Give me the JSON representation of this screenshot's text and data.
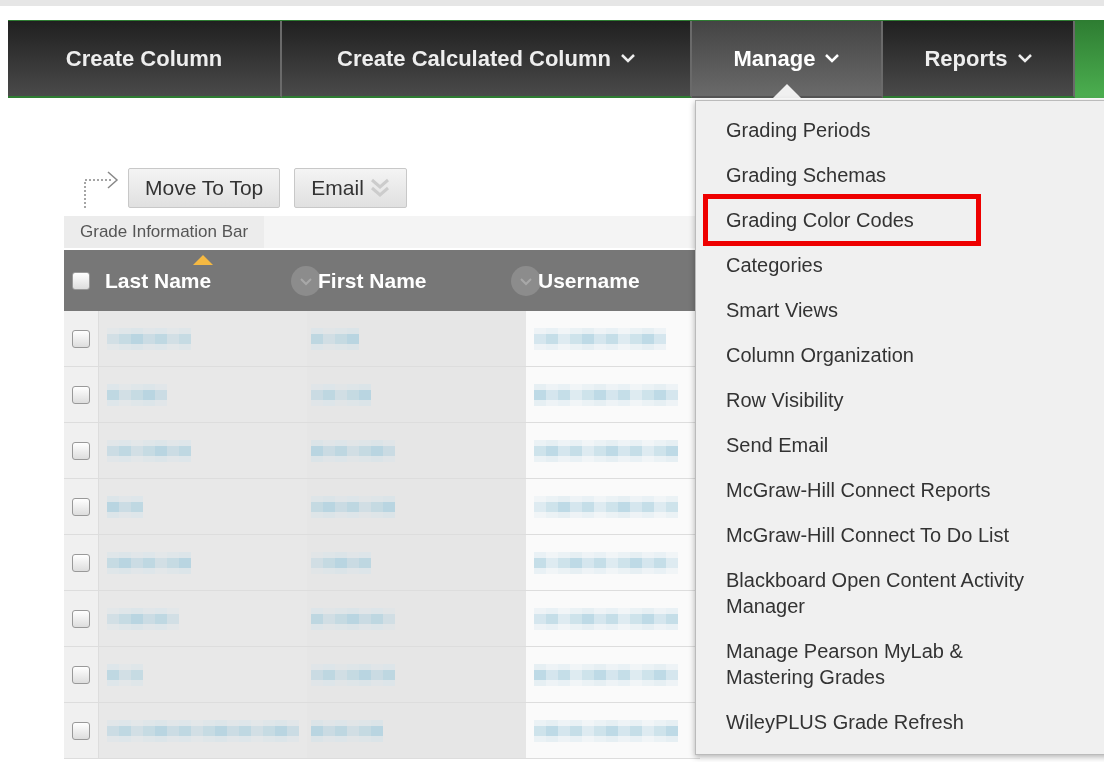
{
  "nav_tabs": [
    {
      "label": "Create Column",
      "has_menu": false,
      "selected": false
    },
    {
      "label": "Create Calculated Column",
      "has_menu": true,
      "selected": false
    },
    {
      "label": "Manage",
      "has_menu": true,
      "selected": true
    },
    {
      "label": "Reports",
      "has_menu": true,
      "selected": false
    }
  ],
  "toolbar": {
    "buttons": [
      {
        "label": "Move To Top",
        "has_menu": false
      },
      {
        "label": "Email",
        "has_menu": true
      }
    ]
  },
  "info_bar": {
    "label": "Grade Information Bar"
  },
  "table": {
    "select_all_checked": false,
    "columns": [
      {
        "label": "Last Name",
        "sorted": true
      },
      {
        "label": "First Name",
        "sorted": false
      },
      {
        "label": "Username",
        "sorted": false
      }
    ],
    "rows": [
      {
        "checked": false
      },
      {
        "checked": false
      },
      {
        "checked": false
      },
      {
        "checked": false
      },
      {
        "checked": false
      },
      {
        "checked": false
      },
      {
        "checked": false
      },
      {
        "checked": false
      }
    ]
  },
  "menu": {
    "items": [
      {
        "label": "Grading Periods",
        "highlighted": false
      },
      {
        "label": "Grading Schemas",
        "highlighted": false
      },
      {
        "label": "Grading Color Codes",
        "highlighted": true
      },
      {
        "label": "Categories",
        "highlighted": false
      },
      {
        "label": "Smart Views",
        "highlighted": false
      },
      {
        "label": "Column Organization",
        "highlighted": false
      },
      {
        "label": "Row Visibility",
        "highlighted": false
      },
      {
        "label": "Send Email",
        "highlighted": false
      },
      {
        "label": "McGraw-Hill Connect Reports",
        "highlighted": false
      },
      {
        "label": "McGraw-Hill Connect To Do List",
        "highlighted": false
      },
      {
        "label": "Blackboard Open Content Activity Manager",
        "highlighted": false
      },
      {
        "label": "Manage Pearson MyLab & Mastering Grades",
        "highlighted": false
      },
      {
        "label": "WileyPLUS Grade Refresh",
        "highlighted": false
      }
    ]
  }
}
